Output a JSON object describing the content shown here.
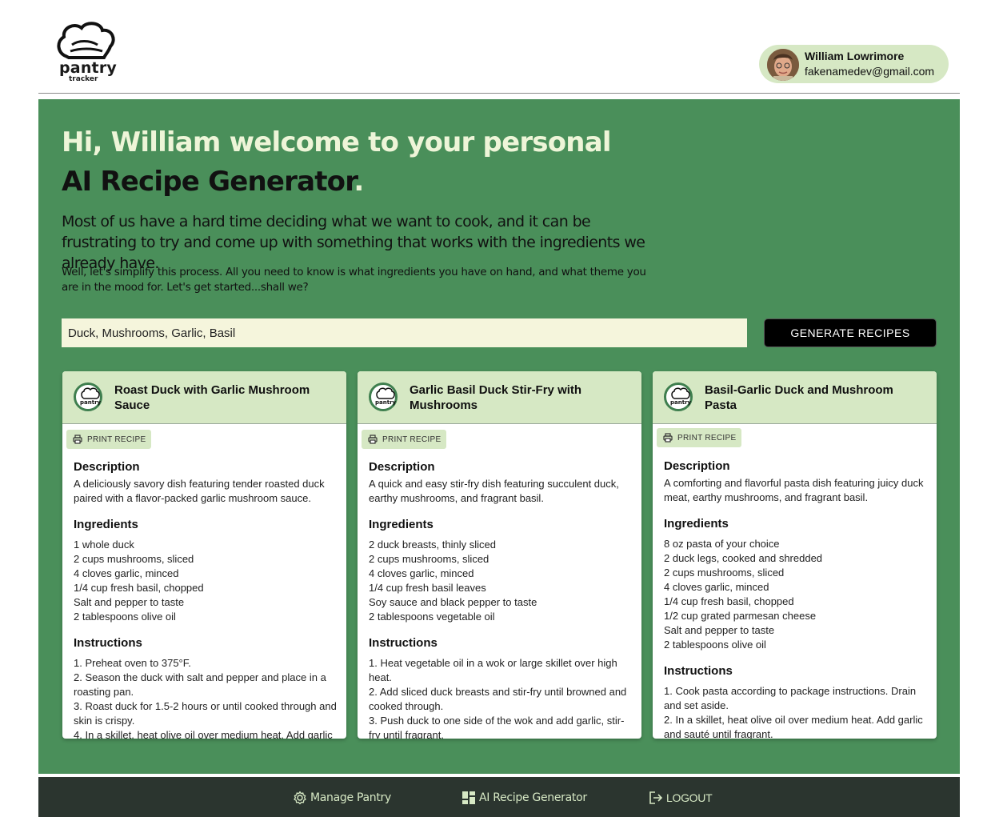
{
  "app": {
    "logo_text": "pantry",
    "logo_subtext": "tracker"
  },
  "user": {
    "name": "William Lowrimore",
    "email": "fakenamedev@gmail.com"
  },
  "hero": {
    "title_prefix": "Hi, William welcome to your personal ",
    "title_emphasis": "AI Recipe Generator",
    "title_suffix": ".",
    "subtitle": "Most of us have a hard time deciding what we want to cook, and it can be frustrating to try and come up with something that works with the ingredients we already have.",
    "note": "Well, let's simplify this process. All you need to know is what ingredients you have on hand, and what theme you are in the mood for. Let's get started...shall we?"
  },
  "search": {
    "value": "Duck, Mushrooms, Garlic, Basil",
    "button_label": "GENERATE RECIPES"
  },
  "labels": {
    "print": "PRINT RECIPE",
    "description": "Description",
    "ingredients": "Ingredients",
    "instructions": "Instructions"
  },
  "recipes": [
    {
      "title": "Roast Duck with Garlic Mushroom Sauce",
      "description": "A deliciously savory dish featuring tender roasted duck paired with a flavor-packed garlic mushroom sauce.",
      "ingredients": [
        "1 whole duck",
        "2 cups mushrooms, sliced",
        "4 cloves garlic, minced",
        "1/4 cup fresh basil, chopped",
        "Salt and pepper to taste",
        "2 tablespoons olive oil"
      ],
      "instructions": [
        "1. Preheat oven to 375°F.",
        "2. Season the duck with salt and pepper and place in a roasting pan.",
        "3. Roast duck for 1.5-2 hours or until cooked through and skin is crispy.",
        "4. In a skillet, heat olive oil over medium heat. Add garlic"
      ]
    },
    {
      "title": "Garlic Basil Duck Stir-Fry with Mushrooms",
      "description": "A quick and easy stir-fry dish featuring succulent duck, earthy mushrooms, and fragrant basil.",
      "ingredients": [
        "2 duck breasts, thinly sliced",
        "2 cups mushrooms, sliced",
        "4 cloves garlic, minced",
        "1/4 cup fresh basil leaves",
        "Soy sauce and black pepper to taste",
        "2 tablespoons vegetable oil"
      ],
      "instructions": [
        "1. Heat vegetable oil in a wok or large skillet over high heat.",
        "2. Add sliced duck breasts and stir-fry until browned and cooked through.",
        "3. Push duck to one side of the wok and add garlic, stir-fry until fragrant."
      ]
    },
    {
      "title": "Basil-Garlic Duck and Mushroom Pasta",
      "description": "A comforting and flavorful pasta dish featuring juicy duck meat, earthy mushrooms, and fragrant basil.",
      "ingredients": [
        "8 oz pasta of your choice",
        "2 duck legs, cooked and shredded",
        "2 cups mushrooms, sliced",
        "4 cloves garlic, minced",
        "1/4 cup fresh basil, chopped",
        "1/2 cup grated parmesan cheese",
        "Salt and pepper to taste",
        "2 tablespoons olive oil"
      ],
      "instructions": [
        "1. Cook pasta according to package instructions. Drain and set aside.",
        "2. In a skillet, heat olive oil over medium heat. Add garlic and sauté until fragrant."
      ]
    }
  ],
  "nav": {
    "manage_pantry": "Manage Pantry",
    "recipe_generator": "AI Recipe Generator",
    "logout": "LOGOUT"
  },
  "colors": {
    "primary_green": "#4a8f5a",
    "light_green": "#d6e8c4",
    "footer_dark": "#2b352f",
    "input_bg": "#f5f5dc"
  }
}
